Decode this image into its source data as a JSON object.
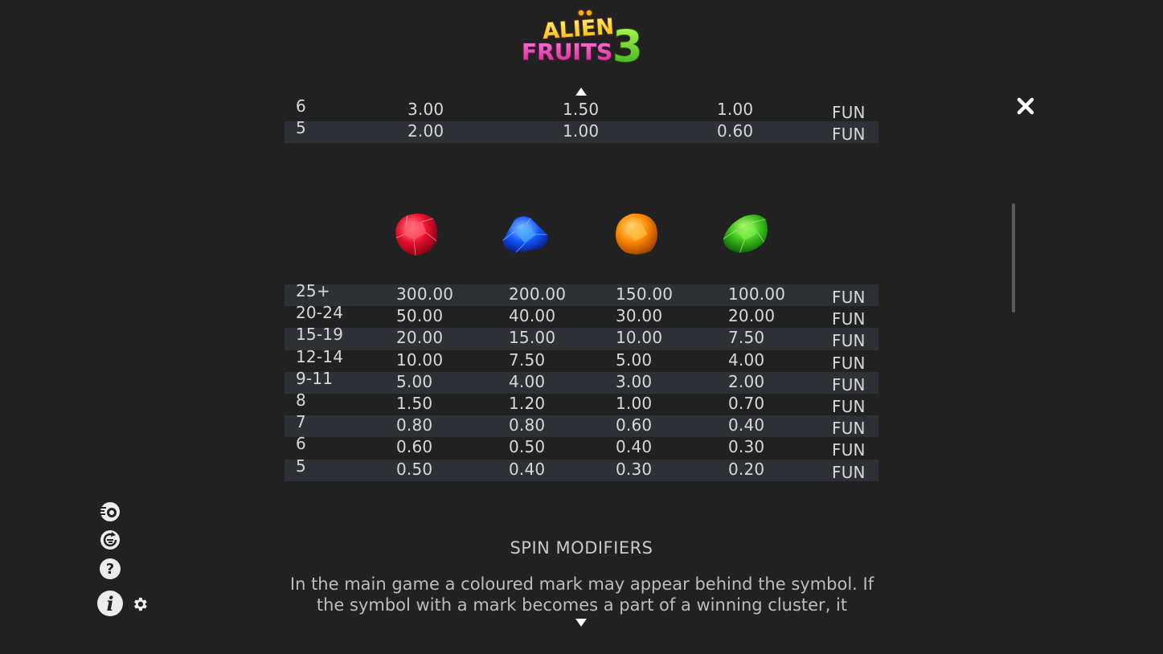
{
  "game": {
    "logo_line1": "ALIEN",
    "logo_line2": "FRUITS",
    "logo_number": "3"
  },
  "icons": {
    "close": "close-icon",
    "scroll_up": "triangle-up-icon",
    "scroll_down": "triangle-down-icon",
    "side_menu": [
      "autoplay-icon",
      "turbo-spin-icon",
      "help-icon",
      "info-icon",
      "gear-icon"
    ]
  },
  "paytable_top": {
    "rows": [
      {
        "count": "6",
        "values": [
          "3.00",
          "1.50",
          "1.00"
        ],
        "currency": "FUN"
      },
      {
        "count": "5",
        "values": [
          "2.00",
          "1.00",
          "0.60"
        ],
        "currency": "FUN"
      }
    ]
  },
  "gems": [
    "red-gem",
    "blue-gem",
    "orange-gem",
    "green-gem"
  ],
  "paytable_gems": {
    "rows": [
      {
        "count": "25+",
        "values": [
          "300.00",
          "200.00",
          "150.00",
          "100.00"
        ],
        "currency": "FUN"
      },
      {
        "count": "20-24",
        "values": [
          "50.00",
          "40.00",
          "30.00",
          "20.00"
        ],
        "currency": "FUN"
      },
      {
        "count": "15-19",
        "values": [
          "20.00",
          "15.00",
          "10.00",
          "7.50"
        ],
        "currency": "FUN"
      },
      {
        "count": "12-14",
        "values": [
          "10.00",
          "7.50",
          "5.00",
          "4.00"
        ],
        "currency": "FUN"
      },
      {
        "count": "9-11",
        "values": [
          "5.00",
          "4.00",
          "3.00",
          "2.00"
        ],
        "currency": "FUN"
      },
      {
        "count": "8",
        "values": [
          "1.50",
          "1.20",
          "1.00",
          "0.70"
        ],
        "currency": "FUN"
      },
      {
        "count": "7",
        "values": [
          "0.80",
          "0.80",
          "0.60",
          "0.40"
        ],
        "currency": "FUN"
      },
      {
        "count": "6",
        "values": [
          "0.60",
          "0.50",
          "0.40",
          "0.30"
        ],
        "currency": "FUN"
      },
      {
        "count": "5",
        "values": [
          "0.50",
          "0.40",
          "0.30",
          "0.20"
        ],
        "currency": "FUN"
      }
    ]
  },
  "spin_modifiers": {
    "title": "SPIN MODIFIERS",
    "text": "In the main game a coloured mark may appear behind the symbol. If the symbol with a mark becomes a part of a winning cluster, it triggers"
  }
}
